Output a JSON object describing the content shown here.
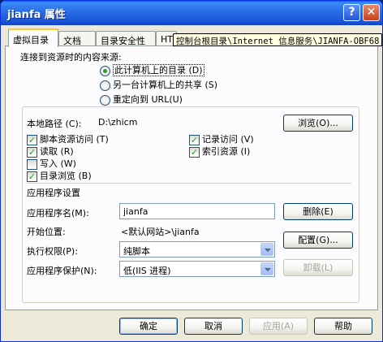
{
  "window": {
    "title": "jianfa 属性",
    "help_glyph": "?",
    "close_glyph": "✕"
  },
  "tabs": [
    {
      "label": "虚拟目录"
    },
    {
      "label": "文档"
    },
    {
      "label": "目录安全性"
    },
    {
      "label": "HTT"
    },
    {
      "label": "控制台根目录\\Internet 信息服务\\JIANFA-OBF68"
    }
  ],
  "source": {
    "heading": "连接到资源时的内容来源:",
    "options": [
      {
        "label": "此计算机上的目录 (D)",
        "checked": true
      },
      {
        "label": "另一台计算机上的共享 (S)",
        "checked": false
      },
      {
        "label": "重定向到 URL(U)",
        "checked": false
      }
    ]
  },
  "local_path": {
    "label": "本地路径 (C):",
    "value": "D:\\zhicm",
    "browse": "浏览(O)..."
  },
  "checks": [
    {
      "label": "脚本资源访问 (T)",
      "checked": true
    },
    {
      "label": "记录访问 (V)",
      "checked": true
    },
    {
      "label": "读取 (R)",
      "checked": true
    },
    {
      "label": "索引资源 (I)",
      "checked": true
    },
    {
      "label": "写入 (W)",
      "checked": false
    },
    {
      "label": "目录浏览 (B)",
      "checked": true
    }
  ],
  "check_mark": "✓",
  "app": {
    "heading": "应用程序设置",
    "name_label": "应用程序名(M):",
    "name_value": "jianfa",
    "remove": "删除(E)",
    "start_label": "开始位置:",
    "start_value": "<默认网站>\\jianfa",
    "perm_label": "执行权限(P):",
    "perm_value": "纯脚本",
    "config": "配置(G)...",
    "protect_label": "应用程序保护(N):",
    "protect_value": "低(IIS 进程)",
    "unload": "卸载(L)"
  },
  "footer": {
    "ok": "确定",
    "cancel": "取消",
    "apply": "应用(A)",
    "help": "帮助"
  }
}
